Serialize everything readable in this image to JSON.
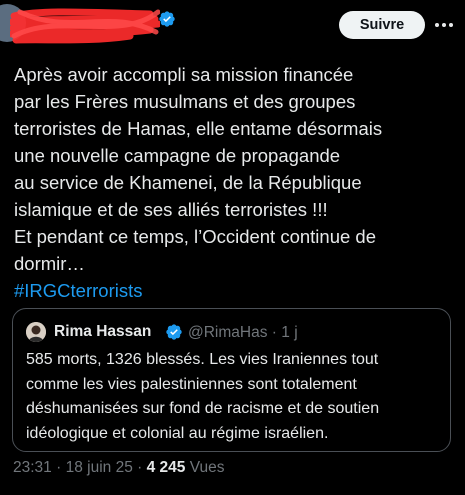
{
  "header": {
    "follow_label": "Suivre"
  },
  "tweet": {
    "lines": [
      "Après avoir accompli sa mission financée",
      "par les Frères musulmans et des groupes",
      "terroristes de Hamas, elle entame désormais",
      "une nouvelle campagne de propagande",
      "au service de Khamenei, de la République",
      "islamique et de ses alliés terroristes !!!",
      "Et pendant ce temps, l’Occident continue de",
      "dormir…"
    ],
    "hashtag": "#IRGCterrorists"
  },
  "quote": {
    "name": "Rima Hassan",
    "handle": "@RimaHas",
    "separator": "·",
    "age": "1 j",
    "lines": [
      "585 morts, 1326 blessés. Les vies Iraniennes tout",
      "comme les vies palestiniennes sont totalement",
      "déshumanisées sur fond de racisme et de soutien",
      "idéologique et colonial au régime israélien."
    ]
  },
  "meta": {
    "time": "23:31",
    "sep1": "·",
    "date": "18 juin 25",
    "sep2": "·",
    "views_count": "4 245",
    "views_label": "Vues"
  },
  "colors": {
    "background": "#000000",
    "text": "#e7e9ea",
    "muted": "#71767b",
    "link": "#1d9bf0",
    "verified": "#1d9bf0",
    "redaction": "#ff2d2d"
  },
  "icons": {
    "verified": "verified-badge-icon",
    "more": "more-horizontal-icon"
  }
}
